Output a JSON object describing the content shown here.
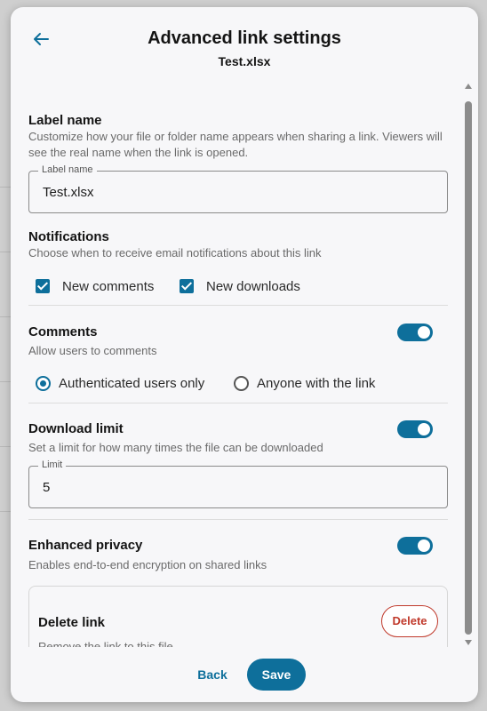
{
  "header": {
    "title": "Advanced link settings",
    "subtitle": "Test.xlsx",
    "back_icon": "arrow-left-icon"
  },
  "label_name": {
    "title": "Label name",
    "description": "Customize how your file or folder name appears when sharing a link. Viewers will see the real name when the link is opened.",
    "field_label": "Label name",
    "field_value": "Test.xlsx"
  },
  "notifications": {
    "title": "Notifications",
    "description": "Choose when to receive email notifications about this link",
    "options": [
      {
        "label": "New comments",
        "checked": true
      },
      {
        "label": "New downloads",
        "checked": true
      }
    ]
  },
  "comments": {
    "title": "Comments",
    "description": "Allow users to comments",
    "enabled": true,
    "options": [
      {
        "label": "Authenticated users only",
        "selected": true
      },
      {
        "label": "Anyone with the link",
        "selected": false
      }
    ]
  },
  "download_limit": {
    "title": "Download limit",
    "description": "Set a limit for how many times the file can be downloaded",
    "enabled": true,
    "field_label": "Limit",
    "field_value": "5"
  },
  "enhanced_privacy": {
    "title": "Enhanced privacy",
    "description": "Enables end-to-end encryption on shared links",
    "enabled": true
  },
  "delete_link": {
    "title": "Delete link",
    "description": "Remove the link to this file.",
    "button_label": "Delete"
  },
  "footer": {
    "back_label": "Back",
    "save_label": "Save"
  },
  "colors": {
    "accent": "#0e6f9b",
    "danger": "#c0392b"
  }
}
